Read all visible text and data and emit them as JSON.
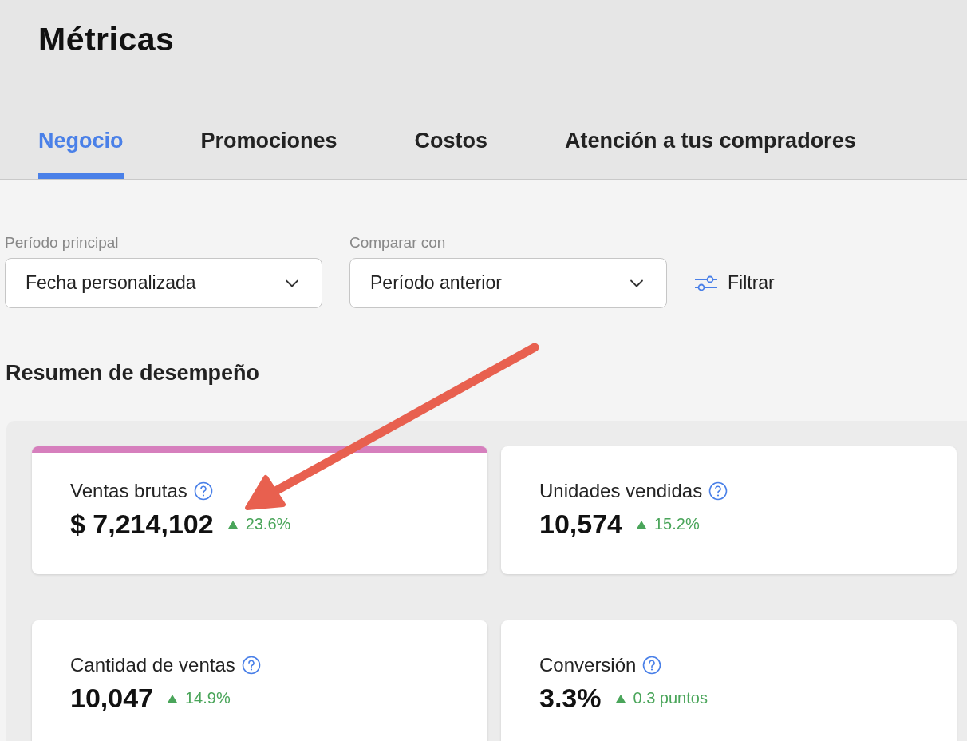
{
  "header": {
    "title": "Métricas"
  },
  "tabs": [
    {
      "label": "Negocio",
      "selected": true
    },
    {
      "label": "Promociones",
      "selected": false
    },
    {
      "label": "Costos",
      "selected": false
    },
    {
      "label": "Atención a tus compradores",
      "selected": false
    }
  ],
  "filters": [
    {
      "label": "Período principal",
      "value": "Fecha personalizada"
    },
    {
      "label": "Comparar con",
      "value": "Período anterior"
    }
  ],
  "filter_button": "Filtrar",
  "section_title": "Resumen de desempeño",
  "metrics": [
    {
      "label": "Ventas brutas",
      "value": "$ 7,214,102",
      "change": "23.6%",
      "selected": true
    },
    {
      "label": "Unidades vendidas",
      "value": "10,574",
      "change": "15.2%",
      "selected": false
    },
    {
      "label": "Cantidad de ventas",
      "value": "10,047",
      "change": "14.9%",
      "selected": false
    },
    {
      "label": "Conversión",
      "value": "3.3%",
      "change": "0.3 puntos",
      "selected": false
    }
  ]
}
